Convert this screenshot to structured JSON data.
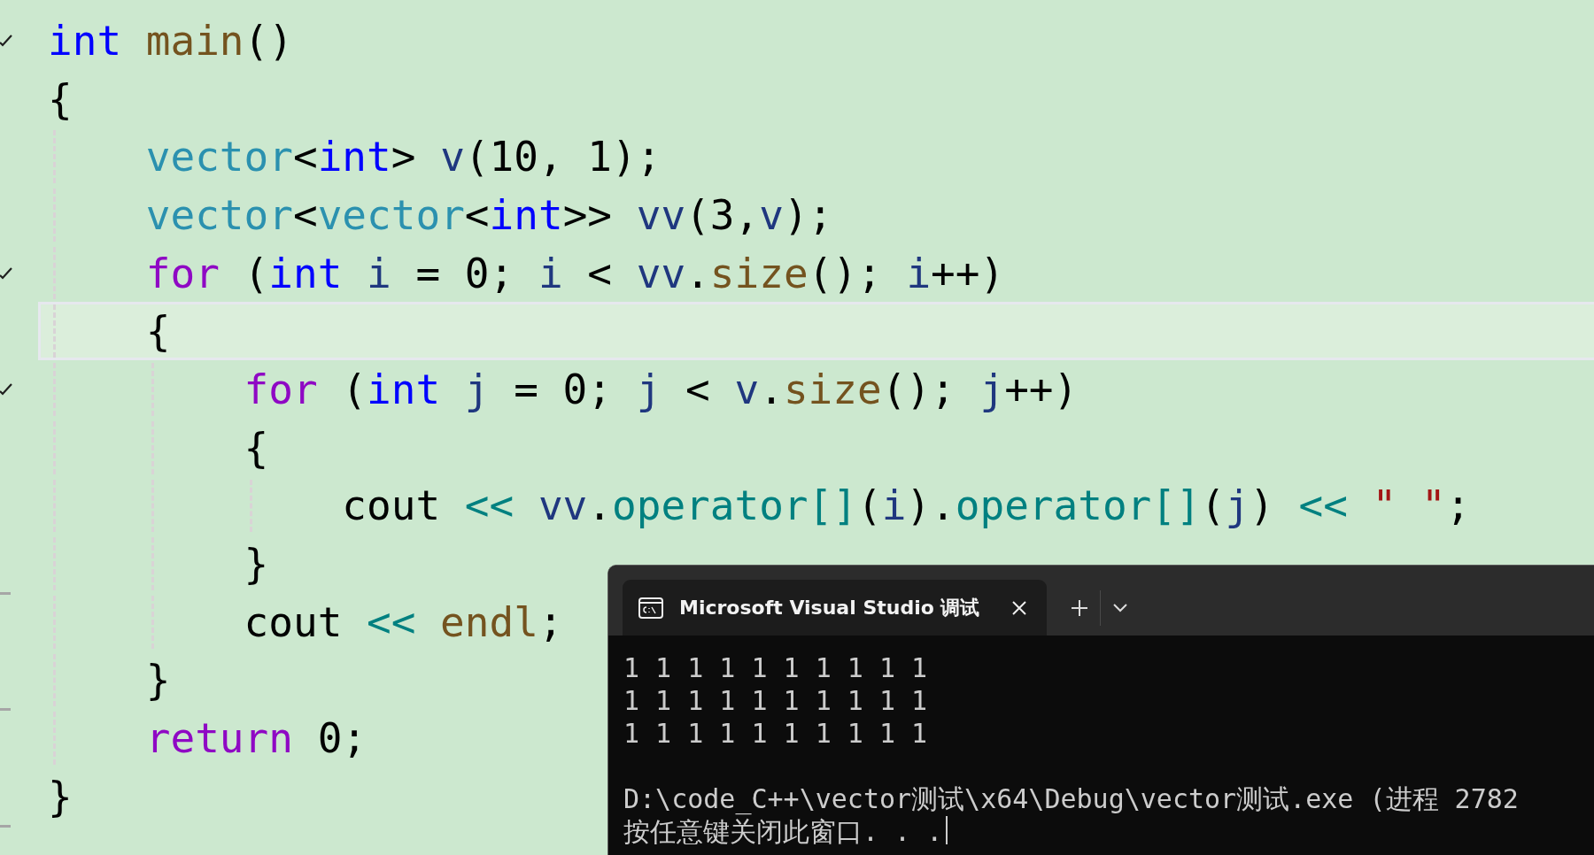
{
  "editor": {
    "lines": [
      {
        "fold_marker": true,
        "end_marker": false,
        "current": false,
        "tokens": [
          {
            "text": "int",
            "kind": "keyword"
          },
          {
            "text": " main",
            "kind": "function"
          },
          {
            "text": "()",
            "kind": "plain"
          }
        ]
      },
      {
        "fold_marker": false,
        "end_marker": false,
        "current": false,
        "tokens": [
          {
            "text": "{",
            "kind": "plain"
          }
        ]
      },
      {
        "fold_marker": false,
        "end_marker": false,
        "current": false,
        "tokens": [
          {
            "text": "    vector",
            "kind": "type"
          },
          {
            "text": "<",
            "kind": "plain"
          },
          {
            "text": "int",
            "kind": "keyword"
          },
          {
            "text": "> ",
            "kind": "plain"
          },
          {
            "text": "v",
            "kind": "variable"
          },
          {
            "text": "(10, 1);",
            "kind": "plain"
          }
        ]
      },
      {
        "fold_marker": false,
        "end_marker": false,
        "current": false,
        "tokens": [
          {
            "text": "    vector",
            "kind": "type"
          },
          {
            "text": "<",
            "kind": "plain"
          },
          {
            "text": "vector",
            "kind": "type"
          },
          {
            "text": "<",
            "kind": "plain"
          },
          {
            "text": "int",
            "kind": "keyword"
          },
          {
            "text": ">> ",
            "kind": "plain"
          },
          {
            "text": "vv",
            "kind": "variable"
          },
          {
            "text": "(3,",
            "kind": "plain"
          },
          {
            "text": "v",
            "kind": "variable"
          },
          {
            "text": ");",
            "kind": "plain"
          }
        ]
      },
      {
        "fold_marker": true,
        "end_marker": false,
        "current": false,
        "tokens": [
          {
            "text": "    for",
            "kind": "control"
          },
          {
            "text": " (",
            "kind": "plain"
          },
          {
            "text": "int",
            "kind": "keyword"
          },
          {
            "text": " i",
            "kind": "variable"
          },
          {
            "text": " = 0; ",
            "kind": "plain"
          },
          {
            "text": "i",
            "kind": "variable"
          },
          {
            "text": " < ",
            "kind": "plain"
          },
          {
            "text": "vv",
            "kind": "variable"
          },
          {
            "text": ".",
            "kind": "plain"
          },
          {
            "text": "size",
            "kind": "function"
          },
          {
            "text": "(); ",
            "kind": "plain"
          },
          {
            "text": "i",
            "kind": "variable"
          },
          {
            "text": "++)",
            "kind": "plain"
          }
        ]
      },
      {
        "fold_marker": false,
        "end_marker": false,
        "current": true,
        "tokens": [
          {
            "text": "    {",
            "kind": "plain"
          }
        ]
      },
      {
        "fold_marker": true,
        "end_marker": false,
        "current": false,
        "tokens": [
          {
            "text": "        for",
            "kind": "control"
          },
          {
            "text": " (",
            "kind": "plain"
          },
          {
            "text": "int",
            "kind": "keyword"
          },
          {
            "text": " j",
            "kind": "variable"
          },
          {
            "text": " = 0; ",
            "kind": "plain"
          },
          {
            "text": "j",
            "kind": "variable"
          },
          {
            "text": " < ",
            "kind": "plain"
          },
          {
            "text": "v",
            "kind": "variable"
          },
          {
            "text": ".",
            "kind": "plain"
          },
          {
            "text": "size",
            "kind": "function"
          },
          {
            "text": "(); ",
            "kind": "plain"
          },
          {
            "text": "j",
            "kind": "variable"
          },
          {
            "text": "++)",
            "kind": "plain"
          }
        ]
      },
      {
        "fold_marker": false,
        "end_marker": false,
        "current": false,
        "tokens": [
          {
            "text": "        {",
            "kind": "plain"
          }
        ]
      },
      {
        "fold_marker": false,
        "end_marker": false,
        "current": false,
        "tokens": [
          {
            "text": "            cout ",
            "kind": "plain"
          },
          {
            "text": "<<",
            "kind": "operator"
          },
          {
            "text": " vv",
            "kind": "variable"
          },
          {
            "text": ".",
            "kind": "plain"
          },
          {
            "text": "operator[]",
            "kind": "operator"
          },
          {
            "text": "(",
            "kind": "plain"
          },
          {
            "text": "i",
            "kind": "variable"
          },
          {
            "text": ").",
            "kind": "plain"
          },
          {
            "text": "operator[]",
            "kind": "operator"
          },
          {
            "text": "(",
            "kind": "plain"
          },
          {
            "text": "j",
            "kind": "variable"
          },
          {
            "text": ") ",
            "kind": "plain"
          },
          {
            "text": "<<",
            "kind": "operator"
          },
          {
            "text": " \" \"",
            "kind": "string"
          },
          {
            "text": ";",
            "kind": "plain"
          }
        ]
      },
      {
        "fold_marker": false,
        "end_marker": true,
        "current": false,
        "tokens": [
          {
            "text": "        }",
            "kind": "plain"
          }
        ]
      },
      {
        "fold_marker": false,
        "end_marker": false,
        "current": false,
        "tokens": [
          {
            "text": "        cout ",
            "kind": "plain"
          },
          {
            "text": "<<",
            "kind": "operator"
          },
          {
            "text": " endl",
            "kind": "function"
          },
          {
            "text": ";",
            "kind": "plain"
          }
        ]
      },
      {
        "fold_marker": false,
        "end_marker": true,
        "current": false,
        "tokens": [
          {
            "text": "    }",
            "kind": "plain"
          }
        ]
      },
      {
        "fold_marker": false,
        "end_marker": false,
        "current": false,
        "tokens": [
          {
            "text": "    return",
            "kind": "control"
          },
          {
            "text": " 0;",
            "kind": "plain"
          }
        ]
      },
      {
        "fold_marker": false,
        "end_marker": true,
        "current": false,
        "tokens": [
          {
            "text": "}",
            "kind": "plain"
          }
        ]
      }
    ]
  },
  "terminal": {
    "tab": {
      "title": "Microsoft Visual Studio 调试"
    },
    "output": [
      "1 1 1 1 1 1 1 1 1 1",
      "1 1 1 1 1 1 1 1 1 1",
      "1 1 1 1 1 1 1 1 1 1"
    ],
    "status": [
      "D:\\code_C++\\vector测试\\x64\\Debug\\vector测试.exe (进程 2782",
      "按任意键关闭此窗口. . ."
    ]
  }
}
